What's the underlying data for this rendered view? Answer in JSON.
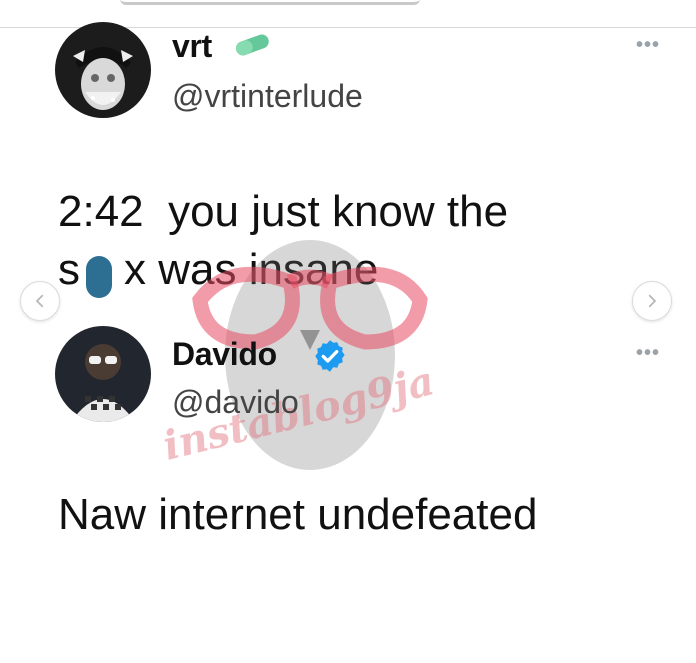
{
  "tweet1": {
    "name": "vrt",
    "handle": "@vrtinterlude",
    "more": "•••",
    "text": "2:42  you just know the\ns x was insane",
    "badge_icon": "pill-emoji-icon"
  },
  "tweet2": {
    "name": "Davido",
    "handle": "@davido",
    "more": "•••",
    "text": "Naw internet undefeated",
    "badge_icon": "verified-badge-icon"
  },
  "watermark": {
    "text": "instablog9ja"
  },
  "carousel": {
    "prev_icon": "chevron-left-icon",
    "next_icon": "chevron-right-icon"
  },
  "colors": {
    "verified": "#1d9bf0",
    "watermark_pink": "#e46f7d",
    "text": "#111111"
  }
}
